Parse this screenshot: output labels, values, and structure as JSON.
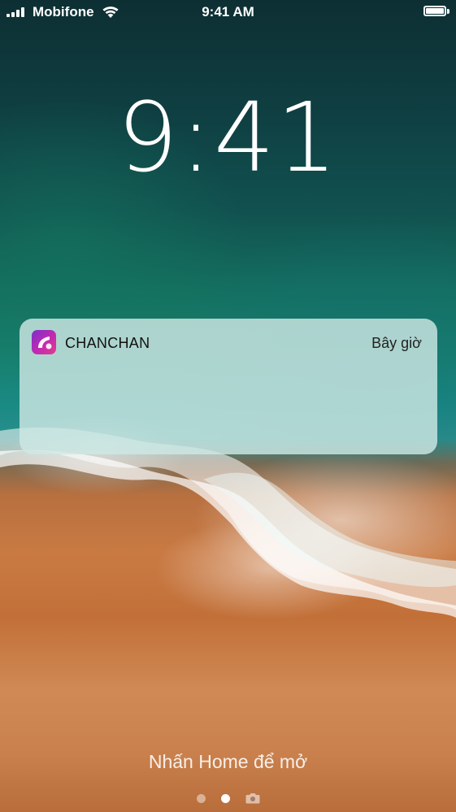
{
  "status_bar": {
    "carrier": "Mobifone",
    "time": "9:41 AM",
    "signal_bars": 4,
    "battery_level": 1.0
  },
  "lock_screen": {
    "clock": "9:41",
    "unlock_hint": "Nhấn Home để mở",
    "page_indicator": {
      "pages": 2,
      "active_index": 1,
      "trailing_icon": "camera-icon"
    }
  },
  "notification": {
    "app_name": "CHANCHAN",
    "time": "Bây giờ",
    "icon": "chanchan-app-icon",
    "accent_colors": [
      "#7a2fc9",
      "#c32ab0",
      "#e53a8a"
    ]
  }
}
